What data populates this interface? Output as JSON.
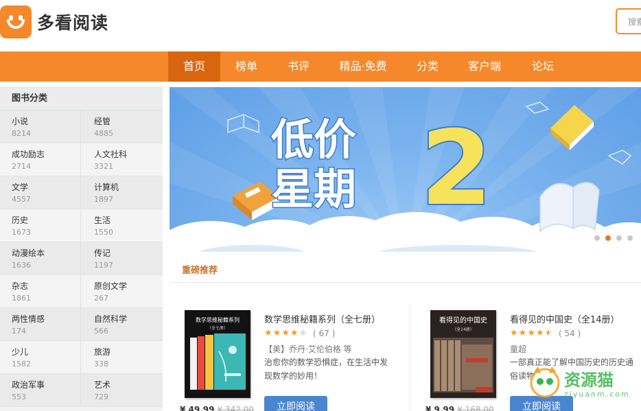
{
  "header": {
    "brand": "多看阅读",
    "search_label": "搜索"
  },
  "nav": {
    "items": [
      {
        "label": "首页"
      },
      {
        "label": "榜单"
      },
      {
        "label": "书评"
      },
      {
        "label": "精品·免费"
      },
      {
        "label": "分类"
      },
      {
        "label": "客户端"
      },
      {
        "label": "论坛"
      }
    ],
    "active_index": 0
  },
  "sidebar": {
    "title": "图书分类",
    "rows": [
      [
        {
          "name": "小说",
          "count": "8214"
        },
        {
          "name": "经管",
          "count": "4885"
        }
      ],
      [
        {
          "name": "成功励志",
          "count": "2714"
        },
        {
          "name": "人文社科",
          "count": "3321"
        }
      ],
      [
        {
          "name": "文学",
          "count": "4557"
        },
        {
          "name": "计算机",
          "count": "1897"
        }
      ],
      [
        {
          "name": "历史",
          "count": "1673"
        },
        {
          "name": "生活",
          "count": "1550"
        }
      ],
      [
        {
          "name": "动漫绘本",
          "count": "1636"
        },
        {
          "name": "传记",
          "count": "1197"
        }
      ],
      [
        {
          "name": "杂志",
          "count": "1861"
        },
        {
          "name": "原创文学",
          "count": "267"
        }
      ],
      [
        {
          "name": "两性情感",
          "count": "174"
        },
        {
          "name": "自然科学",
          "count": "566"
        }
      ],
      [
        {
          "name": "少儿",
          "count": "1582"
        },
        {
          "name": "旅游",
          "count": "338"
        }
      ],
      [
        {
          "name": "政治军事",
          "count": "553"
        },
        {
          "name": "艺术",
          "count": "729"
        }
      ]
    ]
  },
  "banner": {
    "line1": "低价",
    "line2": "星期",
    "numeral": "2",
    "slide_count": 4,
    "active_slide": 1
  },
  "recommend": {
    "title": "重磅推荐",
    "books": [
      {
        "title": "数学思维秘籍系列（全七册）",
        "rating_stars": 4,
        "rating_count": "( 67 )",
        "author": "【美】乔丹·艾伦伯格 等",
        "desc": "治愈你的数学恐惧症，在生活中发现数学的妙用！",
        "button": "立即阅读",
        "price": "¥ 49.99",
        "price_old": "¥ 342.00",
        "cover_title": "数学思维秘籍系列",
        "cover_sub": "（全七册）"
      },
      {
        "title": "看得见的中国史（全14册）",
        "rating_stars": 4.5,
        "rating_count": "( 54 )",
        "author": "童超",
        "desc": "一部真正能了解中国历史的历史通俗读物",
        "button": "立即阅读",
        "price": "¥ 9.99",
        "price_old": "¥ 168.00",
        "cover_title": "看得见的中国史",
        "cover_sub": "（全14册）"
      }
    ]
  },
  "watermark": {
    "text": "资源猫",
    "url": "ziyuanm.com"
  },
  "colors": {
    "brand_orange": "#f5882a",
    "nav_active": "#d8660f",
    "button_blue": "#4a86cf",
    "banner_blue": "#6aa7ea",
    "numeral_yellow": "#f7e25b"
  }
}
